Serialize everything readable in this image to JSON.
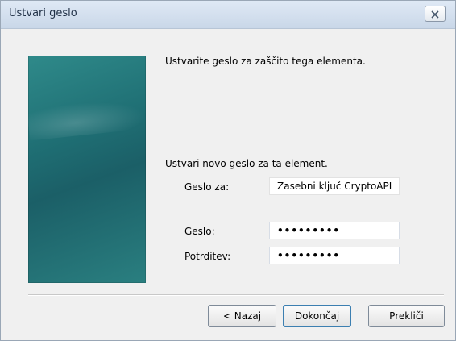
{
  "window": {
    "title": "Ustvari geslo",
    "close_icon": "close-icon"
  },
  "content": {
    "intro_text": "Ustvarite geslo za zaščito tega elementa.",
    "section_text": "Ustvari novo geslo za ta element.",
    "fields": {
      "password_for": {
        "label": "Geslo za:",
        "value": "Zasebni ključ CryptoAPI"
      },
      "password": {
        "label": "Geslo:",
        "value": "•••••••••"
      },
      "confirm": {
        "label": "Potrditev:",
        "value": "•••••••••"
      }
    }
  },
  "buttons": {
    "back": "< Nazaj",
    "finish": "Dokončaj",
    "cancel": "Prekliči"
  },
  "colors": {
    "side_panel": "#1f6f74",
    "titlebar": "#c9d7e8"
  }
}
